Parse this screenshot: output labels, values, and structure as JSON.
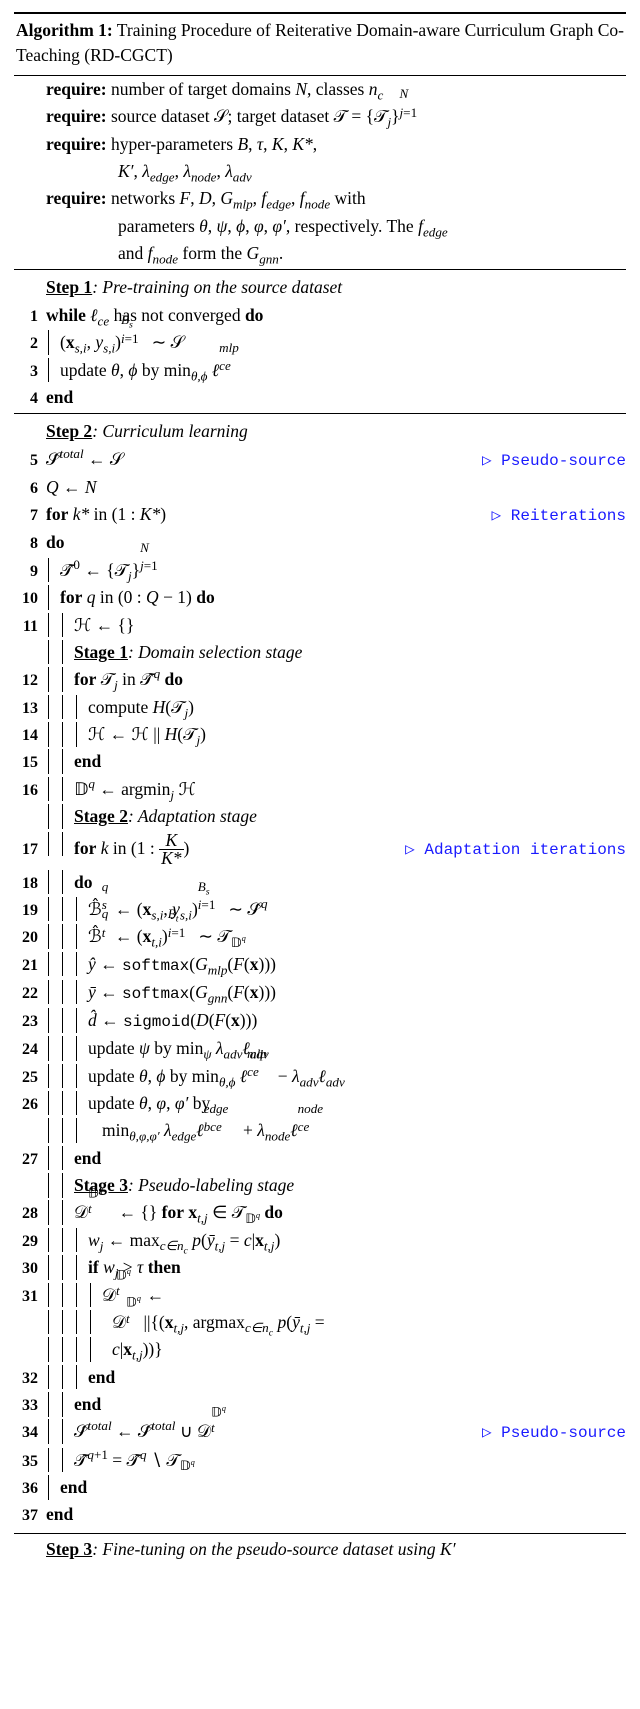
{
  "alg": {
    "label": "Algorithm 1:",
    "title": "Training Procedure of Reiterative Domain-aware Curriculum Graph Co-Teaching (RD-CGCT)",
    "req1": "number of target domains N, classes n_c",
    "req2_pre": "source dataset 𝒮; target dataset 𝒯 = {𝒯_j}",
    "req2_sup": "N",
    "req2_sub": "j=1",
    "req3_l1": "hyper-parameters B, τ, K, K*,",
    "req3_l2": "K′, λ_edge, λ_node, λ_adv",
    "req4_l1": "networks F, D, G_mlp, f_edge, f_node with",
    "req4_l2": "parameters θ, ψ, ϕ, φ, φ′, respectively. The f_edge",
    "req4_l3": "and f_node form the G_gnn.",
    "step1": "Step 1",
    "step1_txt": ": Pre-training on the source dataset",
    "l1": "while ℓ_ce has not converged do",
    "l2": "(x_{s,i}, y_{s,i})_{i=1}^{B_s} ∼ 𝒮",
    "l3": "update θ, ϕ by min_{θ,ϕ} ℓ_{ce}^{mlp}",
    "l4": "end",
    "step2": "Step 2",
    "step2_txt": ": Curriculum learning",
    "l5": "𝒮̂^{total} ← 𝒮",
    "l5_c": "▷ Pseudo-source",
    "l6": "Q ← N",
    "l7": "for k* in (1 : K*)",
    "l7_c": "▷ Reiterations",
    "l8": "do",
    "l9": "𝒯̂^0 ← {𝒯_j}_{j=1}^{N}",
    "l10": "for q in (0 : Q − 1) do",
    "l11": "ℋ ← {}",
    "stage1": "Stage 1",
    "stage1_txt": ": Domain selection stage",
    "l12": "for 𝒯_j in 𝒯̂^q do",
    "l13": "compute H(𝒯_j)",
    "l14": "ℋ ← ℋ || H(𝒯_j)",
    "l15": "end",
    "l16": "𝔻^q ← argmin_j ℋ",
    "stage2": "Stage 2",
    "stage2_txt": ": Adaptation stage",
    "l17": "for k in (1 : K/K*)",
    "l17_c": "▷ Adaptation iterations",
    "l18": "do",
    "l19": "ℬ̂_s^q ← (x_{s,i}, y_{s,i})_{i=1}^{B_s} ∼ 𝒮̂^q",
    "l20": "ℬ̂_t^q ← (x_{t,i})_{i=1}^{B_t} ∼ 𝒯_{𝔻^q}",
    "l21": "ŷ ← softmax(G_mlp(F(x)))",
    "l22": "ȳ ← softmax(G_gnn(F(x)))",
    "l23": "d̂ ← sigmoid(D(F(x)))",
    "l24": "update ψ by min_ψ λ_adv ℓ_adv",
    "l25": "update θ, ϕ by min_{θ,ϕ} ℓ_{ce}^{mlp} − λ_adv ℓ_adv",
    "l26a": "update θ, φ, φ′ by",
    "l26b": "min_{θ,φ,φ′} λ_edge ℓ_{bce}^{edge} + λ_node ℓ_{ce}^{node}",
    "l27": "end",
    "stage3": "Stage 3",
    "stage3_txt": ": Pseudo-labeling stage",
    "l28": "𝒟_t^{𝔻^q} ← {} for x_{t,j} ∈ 𝒯_{𝔻^q} do",
    "l29": "w_j ← max_{c∈n_c} p(ȳ_{t,j} = c | x_{t,j})",
    "l30": "if w_j > τ then",
    "l31a": "𝒟_t^{𝔻^q} ←",
    "l31b": "𝒟_t^{𝔻^q} || {(x_{t,j}, argmax_{c∈n_c} p(ȳ_{t,j} =",
    "l31c": "c | x_{t,j}))}",
    "l32": "end",
    "l33": "end",
    "l34": "𝒮̂^{total} ← 𝒮̂^{total} ∪ 𝒟_t^{𝔻^q}",
    "l34_c": "▷ Pseudo-source",
    "l35": "𝒯̂^{q+1} = 𝒯̂^q ∖ 𝒯_{𝔻^q}",
    "l36": "end",
    "l37": "end",
    "step3": "Step 3",
    "step3_txt": ": Fine-tuning on the pseudo-source dataset using K′"
  }
}
